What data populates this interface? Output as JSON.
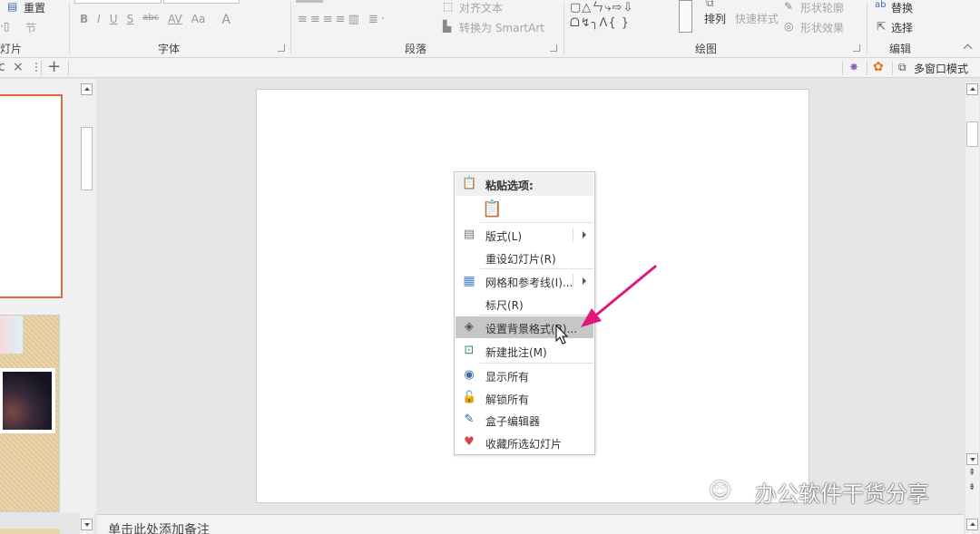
{
  "ribbon": {
    "slides_group": {
      "reset_label": "重置",
      "section_label": "节",
      "group_label": "灯片"
    },
    "font_group": {
      "group_label": "字体",
      "buttons": [
        "B",
        "I",
        "U",
        "S",
        "abc",
        "AV",
        "Aa",
        "A"
      ]
    },
    "paragraph_group": {
      "group_label": "段落",
      "align_text_label": "对齐文本",
      "smartart_label": "转换为 SmartArt"
    },
    "drawing_group": {
      "group_label": "绘图",
      "arrange_label": "排列",
      "quick_styles_label": "快速样式",
      "shape_outline_label": "形状轮廓",
      "shape_effects_label": "形状效果"
    },
    "editing_group": {
      "group_label": "编辑",
      "replace_label": "替换",
      "select_label": "选择"
    }
  },
  "tabbar": {
    "close_glyph": "×",
    "add_glyph": "+",
    "window_mode_label": "多窗口模式"
  },
  "context_menu": {
    "header": "粘贴选项:",
    "items": [
      {
        "label": "版式(L)",
        "icon": "layout-icon",
        "submenu": true
      },
      {
        "label": "重设幻灯片(R)",
        "icon": "",
        "submenu": false
      },
      {
        "label": "网格和参考线(I)...",
        "icon": "grid-icon",
        "submenu": true
      },
      {
        "label": "标尺(R)",
        "icon": "",
        "submenu": false
      },
      {
        "label": "设置背景格式(B)...",
        "icon": "format-background-icon",
        "submenu": false,
        "highlighted": true
      },
      {
        "label": "新建批注(M)",
        "icon": "new-comment-icon",
        "submenu": false
      },
      {
        "label": "显示所有",
        "icon": "eye-icon",
        "submenu": false
      },
      {
        "label": "解锁所有",
        "icon": "unlock-icon",
        "submenu": false
      },
      {
        "label": "盒子编辑器",
        "icon": "edit-icon",
        "submenu": false
      },
      {
        "label": "收藏所选幻灯片",
        "icon": "heart-add-icon",
        "submenu": false
      }
    ]
  },
  "notes": {
    "placeholder": "单击此处添加备注"
  },
  "watermark": {
    "text": "办公软件干货分享"
  },
  "colors": {
    "accent_orange": "#e06841",
    "arrow_pink": "#e0187c",
    "menu_highlight": "#c6c6c6"
  }
}
